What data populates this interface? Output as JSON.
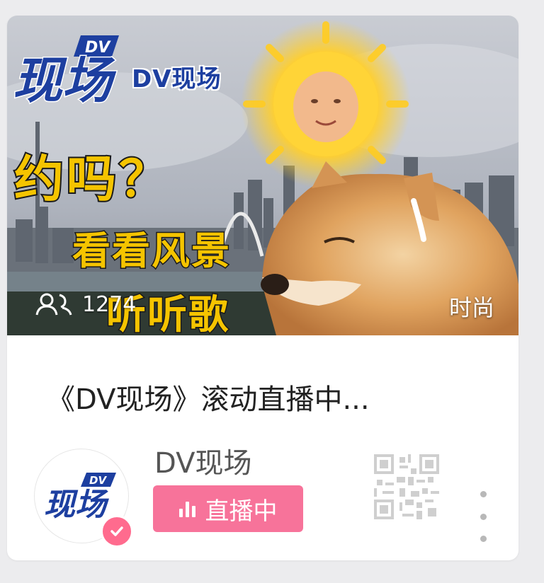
{
  "thumbnail": {
    "logo_word": "DV现场",
    "overlay_line1": "约吗？",
    "overlay_line2": "看看风景",
    "overlay_line3": "听听歌",
    "viewer_count": "1274",
    "category": "时尚"
  },
  "card": {
    "title": "《DV现场》滚动直播中...",
    "channel_name": "DV现场",
    "live_label": "直播中"
  },
  "icons": {
    "viewers": "people-icon",
    "live": "live-bars-icon",
    "verified": "checkmark-icon",
    "qr": "qr-code-icon",
    "more": "more-vertical-icon"
  },
  "colors": {
    "live_badge": "#f7739a",
    "verified_badge": "#ff6b8e",
    "logo_blue": "#1d3fa0",
    "overlay_yellow": "#f5c400"
  }
}
